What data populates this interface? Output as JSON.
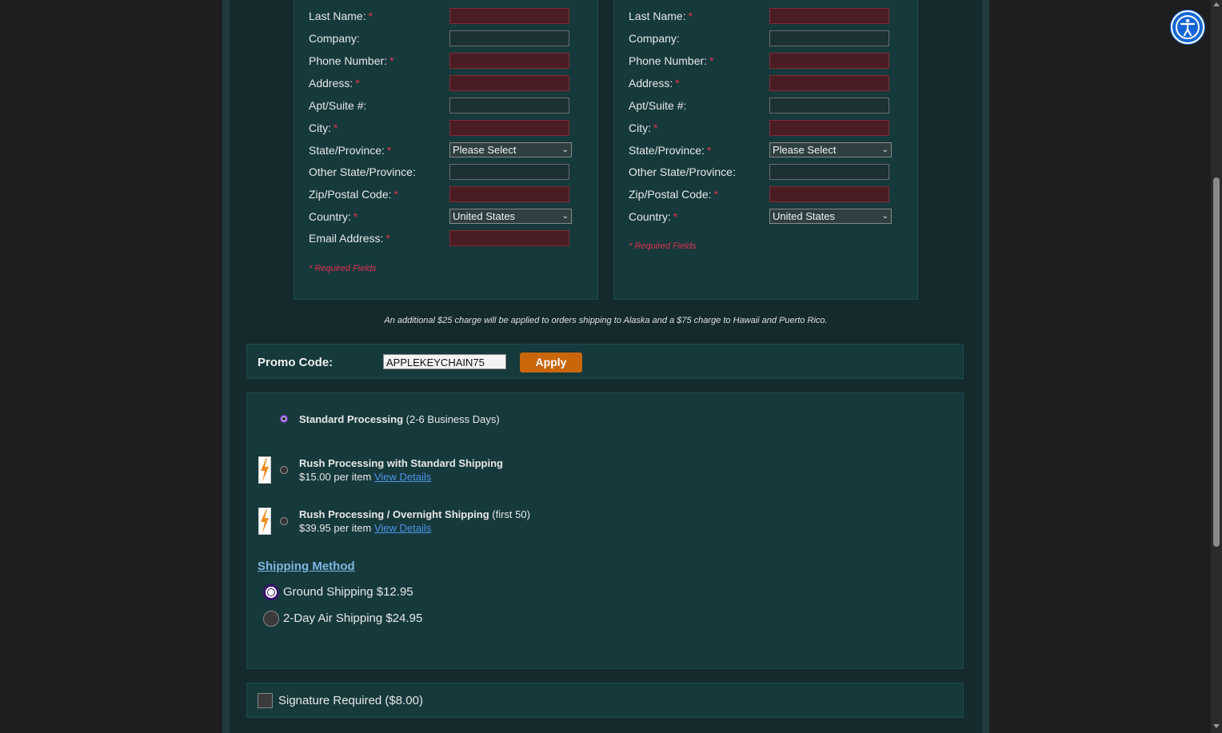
{
  "billing": {
    "fields": [
      {
        "label": "Last Name:",
        "required": true,
        "type": "input"
      },
      {
        "label": "Company:",
        "required": false,
        "type": "input"
      },
      {
        "label": "Phone Number:",
        "required": true,
        "type": "input"
      },
      {
        "label": "Address:",
        "required": true,
        "type": "input"
      },
      {
        "label": "Apt/Suite #:",
        "required": false,
        "type": "input"
      },
      {
        "label": "City:",
        "required": true,
        "type": "input"
      },
      {
        "label": "State/Province:",
        "required": true,
        "type": "select",
        "value": "Please Select"
      },
      {
        "label": "Other State/Province:",
        "required": false,
        "type": "input"
      },
      {
        "label": "Zip/Postal Code:",
        "required": true,
        "type": "input"
      },
      {
        "label": "Country:",
        "required": true,
        "type": "select",
        "value": "United States"
      },
      {
        "label": "Email Address:",
        "required": true,
        "type": "input"
      }
    ],
    "required_note": "* Required Fields"
  },
  "shipping": {
    "fields": [
      {
        "label": "Last Name:",
        "required": true,
        "type": "input"
      },
      {
        "label": "Company:",
        "required": false,
        "type": "input"
      },
      {
        "label": "Phone Number:",
        "required": true,
        "type": "input"
      },
      {
        "label": "Address:",
        "required": true,
        "type": "input"
      },
      {
        "label": "Apt/Suite #:",
        "required": false,
        "type": "input"
      },
      {
        "label": "City:",
        "required": true,
        "type": "input"
      },
      {
        "label": "State/Province:",
        "required": true,
        "type": "select",
        "value": "Please Select"
      },
      {
        "label": "Other State/Province:",
        "required": false,
        "type": "input"
      },
      {
        "label": "Zip/Postal Code:",
        "required": true,
        "type": "input"
      },
      {
        "label": "Country:",
        "required": true,
        "type": "select",
        "value": "United States"
      }
    ],
    "required_note": "* Required Fields"
  },
  "required_marker": "*",
  "surcharge_note": "An additional $25 charge will be applied to orders shipping to Alaska and a $75 charge to Hawaii and Puerto Rico.",
  "promo": {
    "label": "Promo Code:",
    "value": "APPLEKEYCHAIN75",
    "apply_label": "Apply"
  },
  "processing": {
    "standard": {
      "title": "Standard Processing",
      "detail": "(2-6 Business Days)",
      "selected": true
    },
    "rush_standard": {
      "title": "Rush Processing with Standard Shipping",
      "price": "$15.00 per item",
      "link": "View Details",
      "icon": "lightning-bolt-icon"
    },
    "rush_overnight": {
      "title": "Rush Processing / Overnight Shipping",
      "detail": "(first 50)",
      "price": "$39.95 per item",
      "link": "View Details",
      "icon": "lightning-bolt-icon"
    }
  },
  "shipping_method": {
    "heading": "Shipping Method",
    "options": [
      {
        "label": "Ground Shipping $12.95",
        "selected": true
      },
      {
        "label": "2-Day Air Shipping $24.95",
        "selected": false
      }
    ]
  },
  "signature": {
    "label": "Signature Required ($8.00)",
    "checked": false
  },
  "accessibility": {
    "icon": "accessibility-icon"
  },
  "colors": {
    "page_bg": "#1e1e1e",
    "panel_bg": "#16393c",
    "required": "#e0314b",
    "accent_orange": "#c9660a",
    "link": "#4f95e8",
    "accessibility_blue": "#1466d8"
  }
}
